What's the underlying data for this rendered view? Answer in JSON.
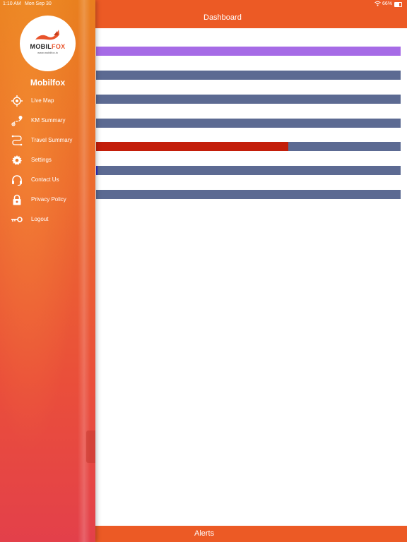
{
  "status_bar": {
    "time": "1:10 AM",
    "date": "Mon Sep 30",
    "battery": "66%",
    "battery_level": 0.66
  },
  "header": {
    "title": "Dashboard"
  },
  "footer": {
    "label": "Alerts"
  },
  "colors": {
    "accent": "#ec5a25",
    "bar_track": "#5c6a92",
    "bar_purple": "#a66be6",
    "bar_red": "#c31e0a",
    "bar_blue": "#2a2ec8"
  },
  "bars": [
    {
      "fill_fraction": 1.0,
      "fill_color": "#a66be6"
    },
    {
      "fill_fraction": 0.0,
      "fill_color": "#5c6a92"
    },
    {
      "fill_fraction": 0.0,
      "fill_color": "#5c6a92"
    },
    {
      "fill_fraction": 0.0,
      "fill_color": "#5c6a92"
    },
    {
      "fill_fraction": 0.63,
      "fill_color": "#c31e0a"
    },
    {
      "fill_fraction": 0.005,
      "fill_color": "#2a2ec8"
    },
    {
      "fill_fraction": 0.0,
      "fill_color": "#5c6a92"
    }
  ],
  "sidebar": {
    "logo": {
      "text_main": "MOBIL",
      "text_accent": "FOX",
      "sub": "www.mobilfox.in"
    },
    "brand": "Mobilfox",
    "items": [
      {
        "label": "Live Map",
        "icon": "crosshair-icon"
      },
      {
        "label": "KM Summary",
        "icon": "route-icon"
      },
      {
        "label": "Travel Summary",
        "icon": "path-icon"
      },
      {
        "label": "Settings",
        "icon": "gear-icon"
      },
      {
        "label": "Contact Us",
        "icon": "headset-icon"
      },
      {
        "label": "Privacy Policy",
        "icon": "lock-icon"
      },
      {
        "label": "Logout",
        "icon": "key-icon"
      }
    ]
  }
}
